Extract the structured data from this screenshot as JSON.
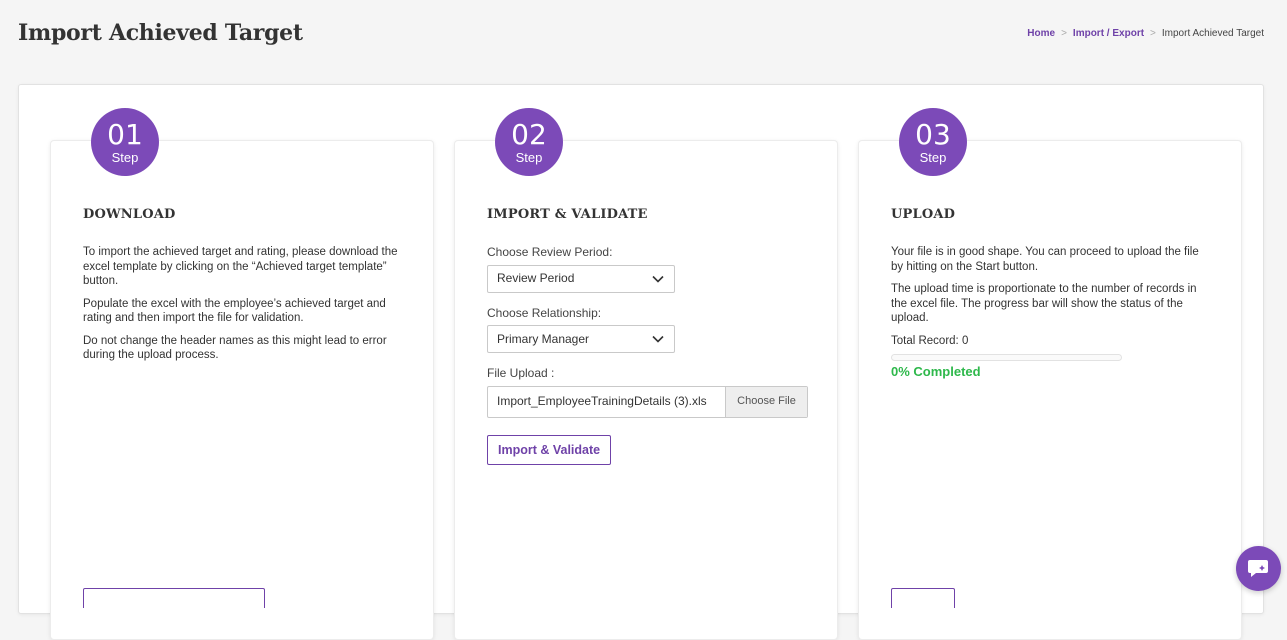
{
  "header": {
    "title": "Import Achieved Target",
    "breadcrumb": {
      "home": "Home",
      "section": "Import / Export",
      "current": "Import Achieved Target",
      "separator": ">"
    }
  },
  "steps": [
    {
      "number": "01",
      "step_word": "Step",
      "title": "DOWNLOAD",
      "paragraphs": [
        "To import the achieved target and rating, please download the excel template by clicking on the “Achieved target template” button.",
        "Populate the excel with the employee’s achieved target and rating and then import the file for validation.",
        "Do not change the header names as this might lead to error during the upload process."
      ]
    },
    {
      "number": "02",
      "step_word": "Step",
      "title": "IMPORT & VALIDATE",
      "review_period": {
        "label": "Choose Review Period:",
        "value": "Review Period"
      },
      "relationship": {
        "label": "Choose Relationship:",
        "value": "Primary Manager"
      },
      "file_upload": {
        "label": "File Upload :",
        "file_name": "Import_EmployeeTrainingDetails (3).xls",
        "button": "Choose File"
      },
      "import_button": "Import & Validate"
    },
    {
      "number": "03",
      "step_word": "Step",
      "title": "UPLOAD",
      "paragraphs": [
        "Your file is in good shape. You can proceed to upload the file by hitting on the Start button.",
        "The upload time is proportionate to the number of records in the excel file. The progress bar will show the status of the upload."
      ],
      "total_record": "Total Record: 0",
      "progress_percent": 0,
      "completed_text": "0% Completed"
    }
  ],
  "icons": {
    "chevron": "chevron-down-icon",
    "chat": "chat-icon"
  },
  "colors": {
    "accent": "#7c4ab8",
    "link": "#6f42a8",
    "success": "#2eb84b"
  }
}
